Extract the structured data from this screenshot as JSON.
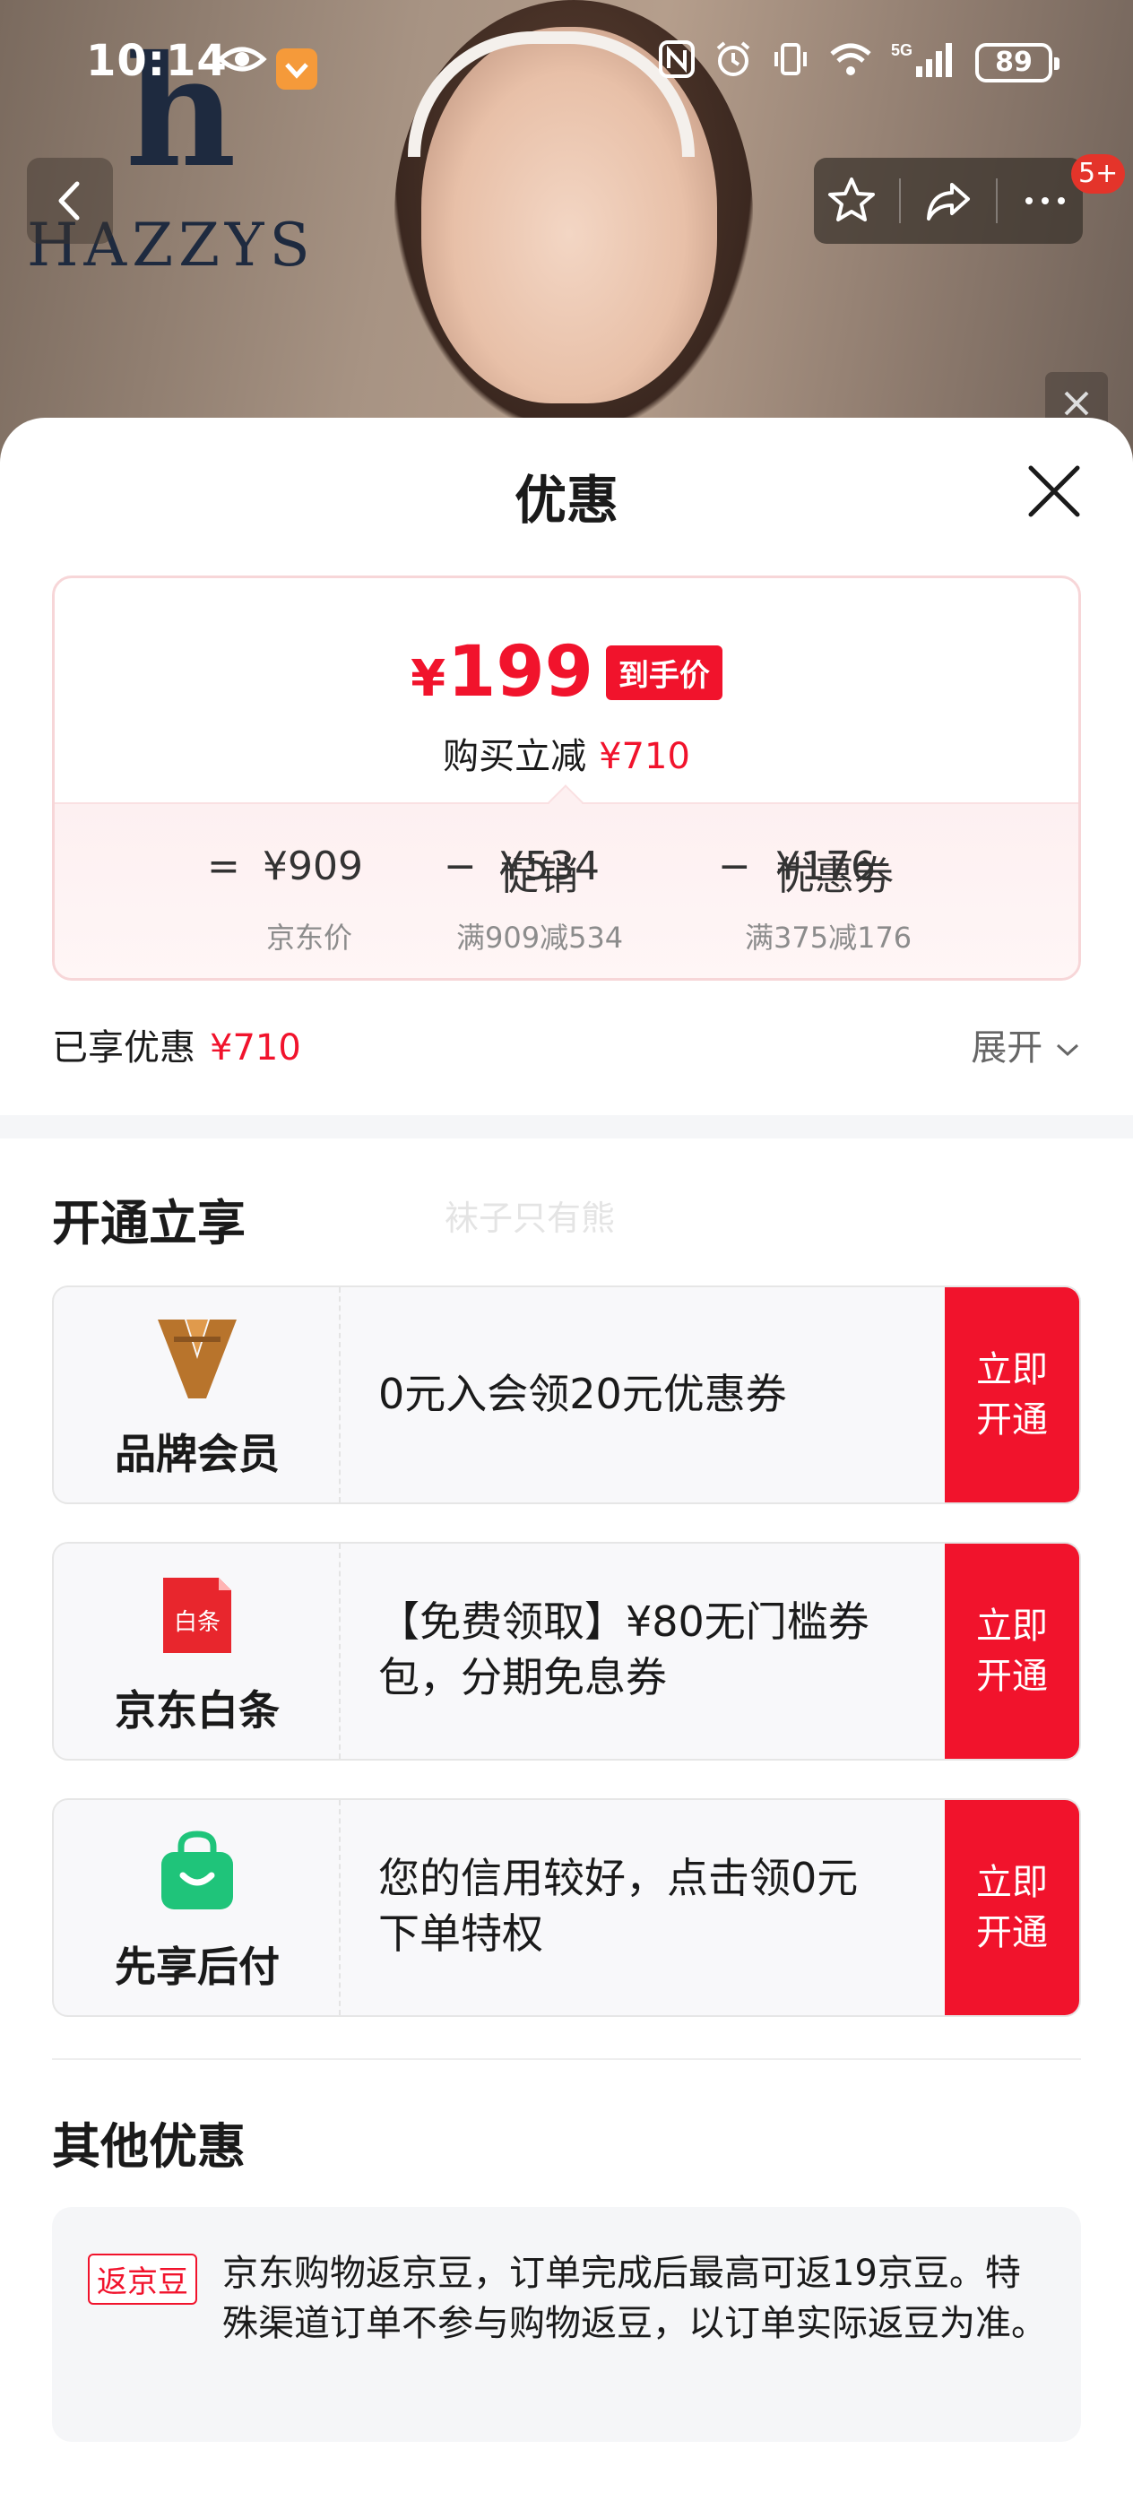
{
  "status_bar": {
    "time": "10:14",
    "battery": "89",
    "network": "5G"
  },
  "brand": {
    "logo_letter": "h",
    "logo_word": "HAZZYS"
  },
  "nav": {
    "message_badge": "5+"
  },
  "sheet": {
    "title": "优惠",
    "price_card": {
      "final_price_symbol": "¥",
      "final_price": "199",
      "final_tag": "到手价",
      "reduce_label": "购买立减",
      "reduce_amount": "¥710",
      "equals": "=",
      "jd_price": "¥909",
      "jd_price_label": "京东价",
      "minus1": "−",
      "promo_label": "促销",
      "promo_amount": "¥534",
      "promo_rule": "满909减534",
      "minus2": "−",
      "coupon_label": "优惠券",
      "coupon_amount": "¥176",
      "coupon_rule": "满375减176"
    },
    "enjoyed_label": "已享优惠",
    "enjoyed_amount": "¥710",
    "expand_label": "展开",
    "open_section_title": "开通立享",
    "watermark": "袜子只有熊",
    "promos": [
      {
        "name": "品牌会员",
        "icon": "brand-member-v-icon",
        "desc": "0元入会领20元优惠券",
        "button_line1": "立即",
        "button_line2": "开通"
      },
      {
        "name": "京东白条",
        "icon": "baitiao-icon",
        "icon_text": "白条",
        "desc": "【免费领取】¥80无门槛券包，分期免息券",
        "button_line1": "立即",
        "button_line2": "开通"
      },
      {
        "name": "先享后付",
        "icon": "shopping-bag-icon",
        "desc": "您的信用较好，点击领0元下单特权",
        "button_line1": "立即",
        "button_line2": "开通"
      }
    ],
    "other_section_title": "其他优惠",
    "other": {
      "tag": "返京豆",
      "text": "京东购物返京豆，订单完成后最高可返19京豆。特殊渠道订单不参与购物返豆，以订单实际返豆为准。"
    }
  },
  "colors": {
    "accent_red": "#f1132c",
    "card_border": "#f7d6d8",
    "baitiao_red": "#e8262d",
    "bag_green": "#1fc47a",
    "brand_gold": "#b8742c"
  }
}
